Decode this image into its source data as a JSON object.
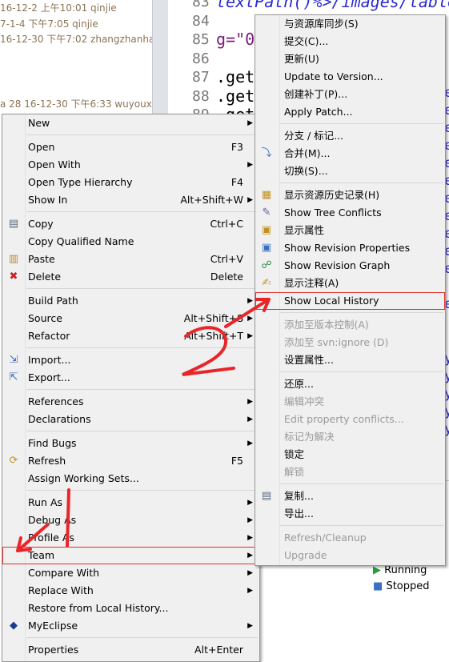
{
  "history": [
    {
      "text": "16-12-2 上午10:01  qinjie"
    },
    {
      "text": "7-1-4 下午7:05  qinjie"
    },
    {
      "text": "16-12-30 下午7:02  zhangzhanha"
    },
    {
      "text": "a 28  16-12-30 下午6:33  wuyoux"
    }
  ],
  "editor": {
    "lines": [
      {
        "num": "83",
        "code": "textPath()%>/images/table"
      },
      {
        "num": "84",
        "code": ""
      },
      {
        "num": "85",
        "code": "g=\"0"
      },
      {
        "num": "86",
        "code": ""
      },
      {
        "num": "87",
        "code": ".get("
      },
      {
        "num": "88",
        "code": ".get("
      },
      {
        "num": "89",
        "code": ".get("
      }
    ]
  },
  "status": {
    "running": "Running",
    "stopped": "Stopped"
  },
  "context_menu": [
    {
      "label": "New",
      "arrow": true
    },
    {
      "sep": true
    },
    {
      "label": "Open",
      "shortcut": "F3"
    },
    {
      "label": "Open With",
      "arrow": true
    },
    {
      "label": "Open Type Hierarchy",
      "shortcut": "F4"
    },
    {
      "label": "Show In",
      "shortcut": "Alt+Shift+W",
      "arrow": true
    },
    {
      "sep": true
    },
    {
      "label": "Copy",
      "shortcut": "Ctrl+C",
      "icon": "copy-icon"
    },
    {
      "label": "Copy Qualified Name"
    },
    {
      "label": "Paste",
      "shortcut": "Ctrl+V",
      "icon": "paste-icon"
    },
    {
      "label": "Delete",
      "shortcut": "Delete",
      "icon": "delete-icon"
    },
    {
      "sep": true
    },
    {
      "label": "Build Path",
      "arrow": true
    },
    {
      "label": "Source",
      "shortcut": "Alt+Shift+S",
      "arrow": true
    },
    {
      "label": "Refactor",
      "shortcut": "Alt+Shift+T",
      "arrow": true
    },
    {
      "sep": true
    },
    {
      "label": "Import...",
      "icon": "import-icon"
    },
    {
      "label": "Export...",
      "icon": "export-icon"
    },
    {
      "sep": true
    },
    {
      "label": "References",
      "arrow": true
    },
    {
      "label": "Declarations",
      "arrow": true
    },
    {
      "sep": true
    },
    {
      "label": "Find Bugs",
      "arrow": true
    },
    {
      "label": "Refresh",
      "shortcut": "F5",
      "icon": "refresh-icon"
    },
    {
      "label": "Assign Working Sets..."
    },
    {
      "sep": true
    },
    {
      "label": "Run As",
      "arrow": true
    },
    {
      "label": "Debug As",
      "arrow": true
    },
    {
      "label": "Profile As",
      "arrow": true
    },
    {
      "label": "Team",
      "arrow": true,
      "highlight": true
    },
    {
      "label": "Compare With",
      "arrow": true
    },
    {
      "label": "Replace With",
      "arrow": true
    },
    {
      "label": "Restore from Local History..."
    },
    {
      "label": "MyEclipse",
      "arrow": true,
      "icon": "myeclipse-icon"
    },
    {
      "sep": true
    },
    {
      "label": "Properties",
      "shortcut": "Alt+Enter"
    }
  ],
  "team_submenu": [
    {
      "label": "与资源库同步(S)"
    },
    {
      "label": "提交(C)..."
    },
    {
      "label": "更新(U)"
    },
    {
      "label": "Update to Version..."
    },
    {
      "label": "创建补丁(P)..."
    },
    {
      "label": "Apply Patch..."
    },
    {
      "sep": true
    },
    {
      "label": "分支 / 标记..."
    },
    {
      "label": "合并(M)...",
      "icon": "merge-icon"
    },
    {
      "label": "切换(S)..."
    },
    {
      "sep": true
    },
    {
      "label": "显示资源历史记录(H)",
      "icon": "history-icon"
    },
    {
      "label": "Show Tree Conflicts",
      "icon": "tree-conflicts-icon"
    },
    {
      "label": "显示属性",
      "icon": "properties-icon"
    },
    {
      "label": "Show Revision Properties",
      "icon": "revision-properties-icon"
    },
    {
      "label": "Show Revision Graph",
      "icon": "revision-graph-icon"
    },
    {
      "label": "显示注释(A)",
      "icon": "annotate-icon"
    },
    {
      "label": "Show Local History",
      "highlight": true
    },
    {
      "sep": true
    },
    {
      "label": "添加至版本控制(A)",
      "disabled": true
    },
    {
      "label": "添加至 svn:ignore (D)",
      "disabled": true
    },
    {
      "label": "设置属性..."
    },
    {
      "sep": true
    },
    {
      "label": "还原..."
    },
    {
      "label": "编辑冲突",
      "disabled": true
    },
    {
      "label": "Edit property conflicts...",
      "disabled": true
    },
    {
      "label": "标记为解决",
      "disabled": true
    },
    {
      "label": "锁定"
    },
    {
      "label": "解锁",
      "disabled": true
    },
    {
      "sep": true
    },
    {
      "label": "复制...",
      "icon": "copy-icon"
    },
    {
      "label": "导出..."
    },
    {
      "sep": true
    },
    {
      "label": "Refresh/Cleanup",
      "disabled": true
    },
    {
      "label": "Upgrade",
      "disabled": true
    }
  ],
  "annotations": {
    "step1": "1",
    "step2": "2",
    "color": "#e8262a"
  }
}
